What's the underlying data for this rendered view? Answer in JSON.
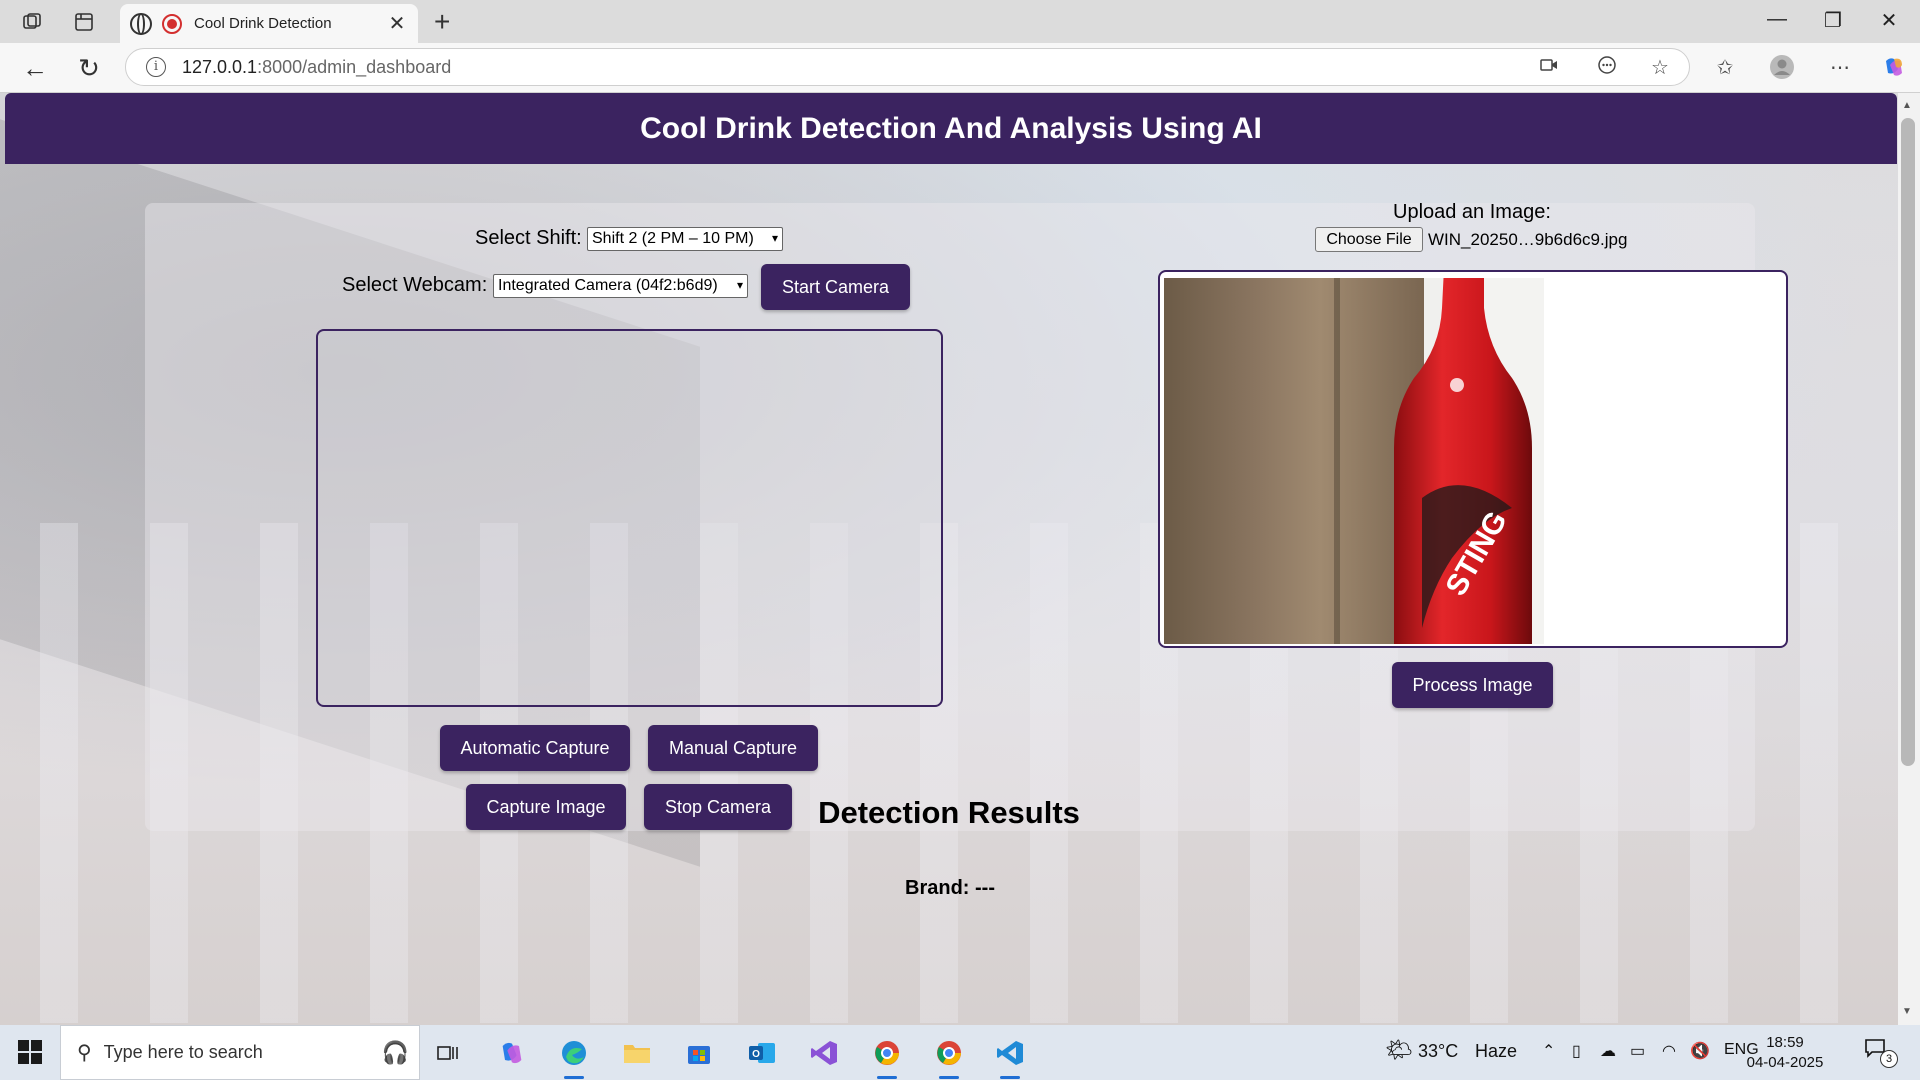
{
  "browser": {
    "tab_title": "Cool Drink Detection",
    "url_host": "127.0.0.1",
    "url_path": ":8000/admin_dashboard",
    "icons": [
      "workspaces-icon",
      "tab-actions-icon",
      "globe-icon",
      "recording-icon",
      "close-icon",
      "new-tab-icon",
      "minimize-icon",
      "maximize-icon",
      "close-window-icon",
      "back-icon",
      "refresh-icon",
      "info-icon",
      "camera-icon",
      "read-aloud-icon",
      "favorite-star-icon",
      "favorites-icon",
      "profile-icon",
      "more-icon",
      "copilot-icon"
    ]
  },
  "page": {
    "title": "Cool Drink Detection And Analysis Using AI",
    "shift_label": "Select Shift:",
    "shift_selected": "Shift 2 (2 PM – 10 PM)",
    "webcam_label": "Select Webcam:",
    "webcam_selected": "Integrated Camera (04f2:b6d9)",
    "start_camera": "Start Camera",
    "automatic_capture": "Automatic Capture",
    "manual_capture": "Manual Capture",
    "capture_image": "Capture Image",
    "stop_camera": "Stop Camera",
    "upload_label": "Upload an Image:",
    "choose_file": "Choose File",
    "file_name": "WIN_20250…9b6d6c9.jpg",
    "process_image": "Process Image",
    "results_heading": "Detection Results",
    "brand_label": "Brand:",
    "brand_value": "---",
    "uploaded_image_text": "STING"
  },
  "taskbar": {
    "search_placeholder": "Type here to search",
    "weather_temp": "33°C",
    "weather_text": "Haze",
    "language": "ENG",
    "time": "18:59",
    "date": "04-04-2025",
    "notification_count": "3"
  },
  "colors": {
    "accent": "#3b2360",
    "banner_text": "#ffffff"
  }
}
